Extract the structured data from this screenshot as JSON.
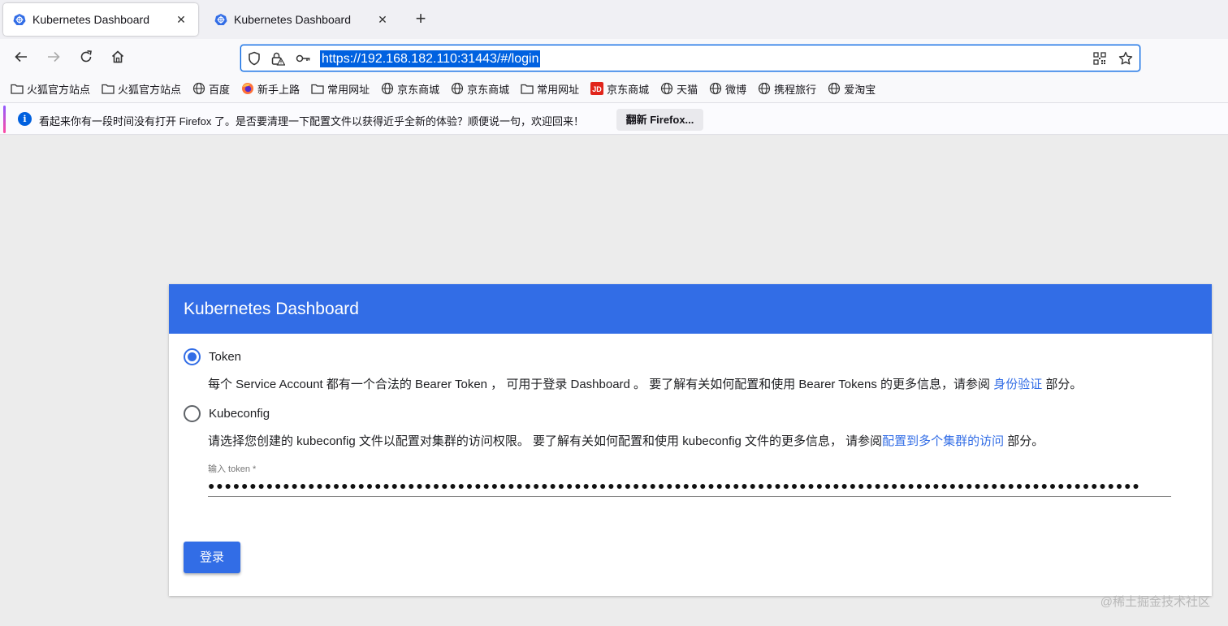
{
  "tabs": [
    {
      "title": "Kubernetes Dashboard",
      "active": true,
      "icon": "kubernetes-icon"
    },
    {
      "title": "Kubernetes Dashboard",
      "active": false,
      "icon": "kubernetes-icon"
    }
  ],
  "navbar": {
    "url": "https://192.168.182.110:31443/#/login"
  },
  "bookmarks": [
    {
      "label": "火狐官方站点",
      "icon": "folder-icon"
    },
    {
      "label": "火狐官方站点",
      "icon": "folder-icon"
    },
    {
      "label": "百度",
      "icon": "globe-icon"
    },
    {
      "label": "新手上路",
      "icon": "firefox-icon"
    },
    {
      "label": "常用网址",
      "icon": "folder-icon"
    },
    {
      "label": "京东商城",
      "icon": "globe-icon"
    },
    {
      "label": "京东商城",
      "icon": "globe-icon"
    },
    {
      "label": "常用网址",
      "icon": "folder-icon"
    },
    {
      "label": "京东商城",
      "icon": "jd-icon"
    },
    {
      "label": "天猫",
      "icon": "globe-icon"
    },
    {
      "label": "微博",
      "icon": "globe-icon"
    },
    {
      "label": "携程旅行",
      "icon": "globe-icon"
    },
    {
      "label": "爱淘宝",
      "icon": "globe-icon"
    }
  ],
  "notification": {
    "text": "看起来你有一段时间没有打开 Firefox 了。是否要清理一下配置文件以获得近乎全新的体验？顺便说一句，欢迎回来！",
    "button": "翻新 Firefox..."
  },
  "login": {
    "header": "Kubernetes Dashboard",
    "token_option": "Token",
    "token_desc_before": "每个 Service Account 都有一个合法的 Bearer Token ， 可用于登录 Dashboard 。 要了解有关如何配置和使用 Bearer Tokens 的更多信息，请参阅 ",
    "token_desc_link": "身份验证",
    "token_desc_after": " 部分。",
    "kubeconfig_option": "Kubeconfig",
    "kube_desc_before": "请选择您创建的 kubeconfig 文件以配置对集群的访问权限。 要了解有关如何配置和使用 kubeconfig 文件的更多信息， 请参阅",
    "kube_desc_link": "配置到多个集群的访问",
    "kube_desc_after": " 部分。",
    "token_label": "输入 token *",
    "token_value": "●●●●●●●●●●●●●●●●●●●●●●●●●●●●●●●●●●●●●●●●●●●●●●●●●●●●●●●●●●●●●●●●●●●●●●●●●●●●●●●●●●●●●●●●●●●●●●●●●●●●●●●●●●●●●●●●",
    "selected_option": "token",
    "submit": "登录"
  },
  "watermark": "@稀土掘金技术社区",
  "colors": {
    "accent": "#326de6",
    "url_highlight": "#0061e0"
  }
}
